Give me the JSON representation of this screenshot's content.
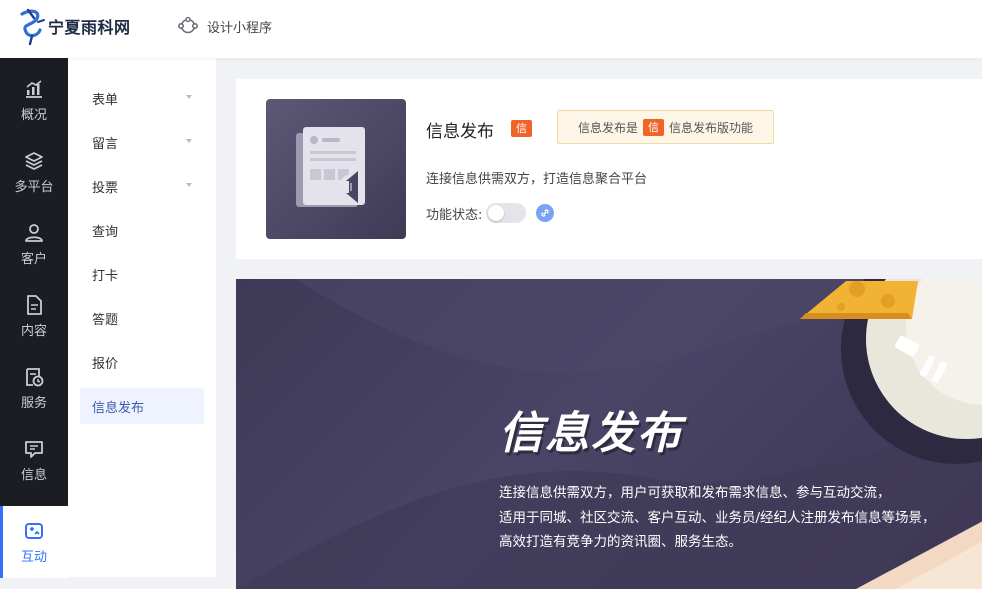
{
  "brand": {
    "name": "宁夏雨科网"
  },
  "topbar": {
    "mini_program_label": "设计小程序"
  },
  "rail": {
    "items": [
      {
        "label": "概况",
        "icon": "chart-icon"
      },
      {
        "label": "多平台",
        "icon": "layers-icon"
      },
      {
        "label": "客户",
        "icon": "user-icon"
      },
      {
        "label": "内容",
        "icon": "document-icon"
      },
      {
        "label": "服务",
        "icon": "service-icon"
      },
      {
        "label": "信息",
        "icon": "message-icon"
      },
      {
        "label": "互动",
        "icon": "interaction-icon",
        "active": true
      }
    ]
  },
  "subnav": {
    "items": [
      {
        "label": "表单",
        "expandable": true
      },
      {
        "label": "留言",
        "expandable": true
      },
      {
        "label": "投票",
        "expandable": true
      },
      {
        "label": "查询"
      },
      {
        "label": "打卡"
      },
      {
        "label": "答题"
      },
      {
        "label": "报价"
      },
      {
        "label": "信息发布",
        "active": true
      }
    ]
  },
  "feature": {
    "title": "信息发布",
    "badge": "信",
    "notice_prefix": "信息发布是",
    "notice_badge": "信",
    "notice_suffix": "信息发布版功能",
    "description": "连接信息供需双方，打造信息聚合平台",
    "status_label": "功能状态:",
    "enabled": false
  },
  "banner": {
    "title": "信息发布",
    "lines": [
      "连接信息供需双方，用户可获取和发布需求信息、参与互动交流，",
      "适用于同城、社区交流、客户互动、业务员/经纪人注册发布信息等场景，",
      "高效打造有竞争力的资讯圈、服务生态。"
    ]
  },
  "colors": {
    "accent": "#3370ff",
    "badge": "#f0642a",
    "rail_bg": "#1c1d22",
    "banner_bg": "#433e5e"
  }
}
